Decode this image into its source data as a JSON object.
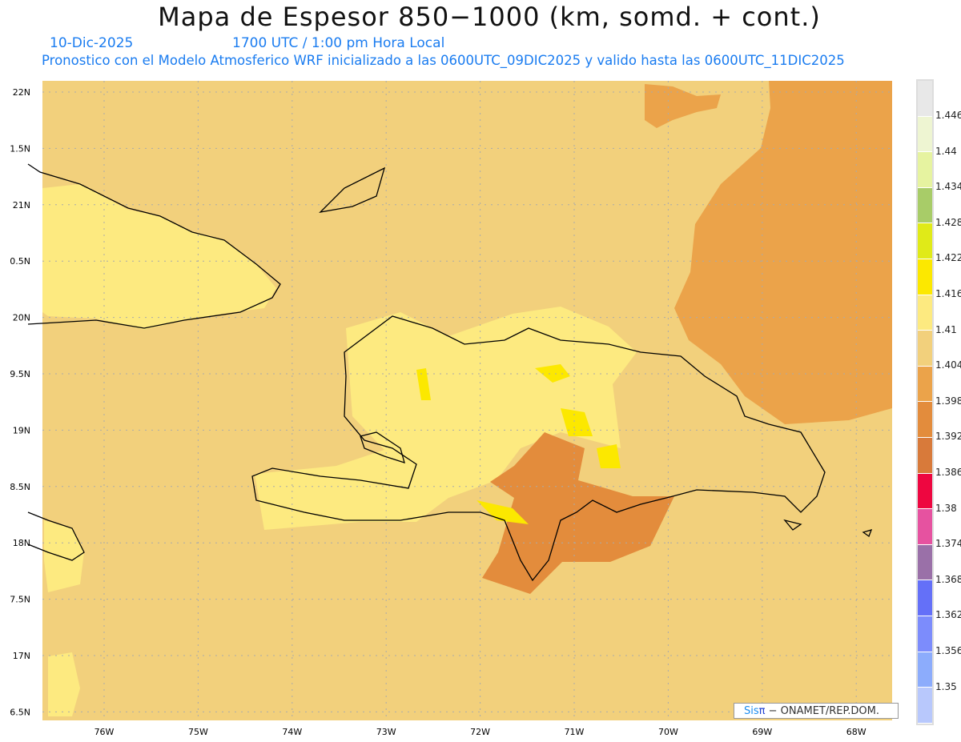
{
  "header": {
    "title": "Mapa de Espesor 850−1000 (km, somd. + cont.)",
    "date": "10-Dic-2025",
    "time": "1700 UTC / 1:00 pm Hora Local",
    "subtitle": "Pronostico con el Modelo Atmosferico WRF inicializado a las 0600UTC_09DIC2025 y valido hasta las  0600UTC_11DIC2025"
  },
  "map": {
    "lat_labels": [
      "22N",
      "1.5N",
      "21N",
      "0.5N",
      "20N",
      "9.5N",
      "19N",
      "8.5N",
      "18N",
      "7.5N",
      "17N",
      "6.5N"
    ],
    "lon_labels": [
      "76W",
      "75W",
      "74W",
      "73W",
      "72W",
      "71W",
      "70W",
      "69W",
      "68W"
    ]
  },
  "colorbar": {
    "labels": [
      "1.446",
      "1.44",
      "1.434",
      "1.428",
      "1.422",
      "1.416",
      "1.41",
      "1.404",
      "1.398",
      "1.392",
      "1.386",
      "1.38",
      "1.374",
      "1.368",
      "1.362",
      "1.356",
      "1.35"
    ],
    "colors": [
      "#e8e8e8",
      "#eef5d2",
      "#e6f3a0",
      "#a8cc68",
      "#e0ea18",
      "#fce800",
      "#fdea80",
      "#f2d07c",
      "#eba34a",
      "#e38c3c",
      "#d87a3a",
      "#ee0640",
      "#e652a0",
      "#9a70a8",
      "#6470f8",
      "#7c8cfc",
      "#8cacfc",
      "#b8c8fc"
    ]
  },
  "credit": {
    "sis": "Sis",
    "pi": "π",
    "rest": " − ONAMET/REP.DOM."
  }
}
